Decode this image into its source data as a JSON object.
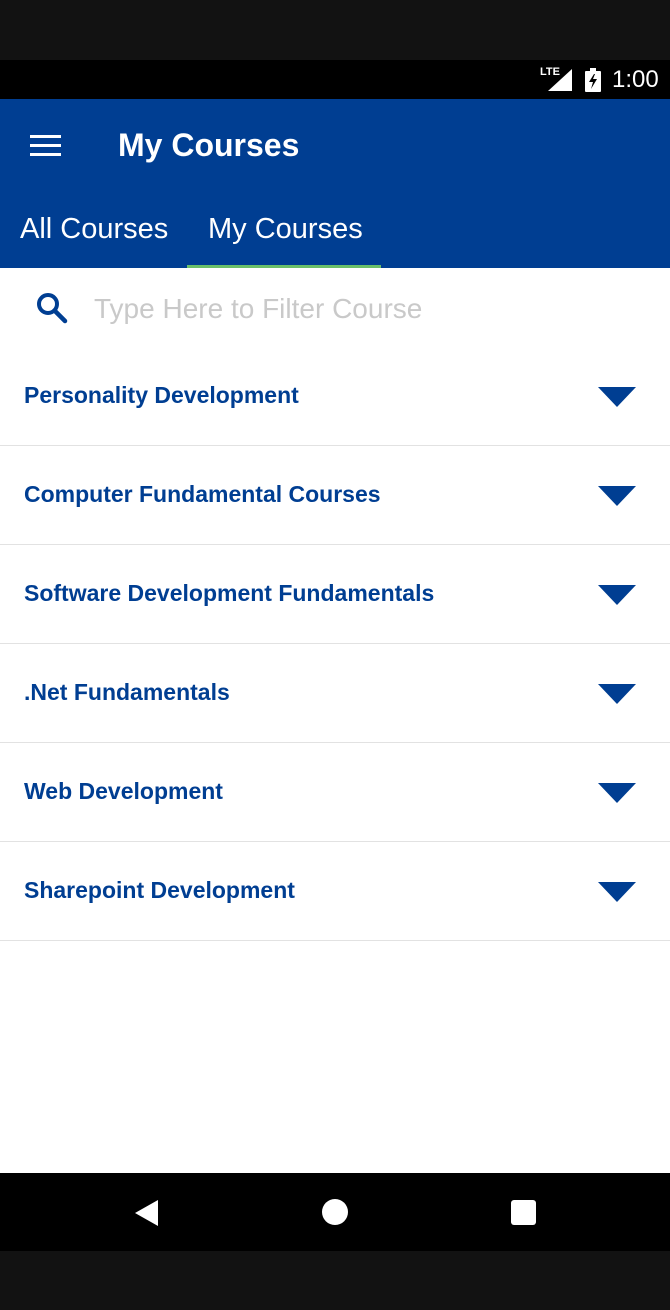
{
  "status_bar": {
    "network": "LTE",
    "time": "1:00"
  },
  "app_bar": {
    "title": "My Courses",
    "menu_icon": "hamburger-menu-icon",
    "background_color": "#003e92"
  },
  "tabs": [
    {
      "label": "All Courses",
      "selected": false
    },
    {
      "label": "My Courses",
      "selected": true
    }
  ],
  "tab_indicator_color": "#6abf6a",
  "search": {
    "icon": "search-icon",
    "placeholder": "Type Here to Filter Course",
    "value": ""
  },
  "courses": [
    {
      "label": "Personality Development"
    },
    {
      "label": "Computer Fundamental Courses"
    },
    {
      "label": "Software Development Fundamentals"
    },
    {
      "label": ".Net Fundamentals"
    },
    {
      "label": "Web Development"
    },
    {
      "label": "Sharepoint Development"
    }
  ],
  "course_expand_icon": "triangle-down-icon",
  "accent_color": "#003e92",
  "nav_bar": {
    "back_icon": "back-triangle-icon",
    "home_icon": "home-circle-icon",
    "recent_icon": "recents-square-icon"
  }
}
